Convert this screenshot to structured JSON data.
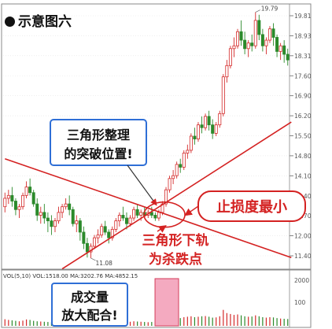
{
  "header": {
    "title": "示意图六"
  },
  "chart_data": {
    "type": "candlestick",
    "title": "示意图六",
    "price_axis": {
      "ticks": [
        "19.81",
        "18.93",
        "18.31",
        "17.60",
        "16.90",
        "16.20",
        "15.50",
        "14.80",
        "14.10",
        "13.40",
        "12.70",
        "12.00",
        "11.40"
      ],
      "ylim": [
        10.8,
        20.0
      ]
    },
    "high_label": "19.79",
    "low_label": "11.08",
    "volume_legend": "VOL(5,10) VOL:1518.00 MA:3202.76 MA:4852.15",
    "volume_axis": {
      "ticks": [
        "2000",
        "100"
      ]
    },
    "candles": [
      [
        12.9,
        13.4,
        13.2,
        12.7
      ],
      [
        13.2,
        13.5,
        13.3,
        13.0
      ],
      [
        13.3,
        13.6,
        13.1,
        12.9
      ],
      [
        13.1,
        13.2,
        12.8,
        12.6
      ],
      [
        12.8,
        13.0,
        12.9,
        12.5
      ],
      [
        12.9,
        13.4,
        13.3,
        12.8
      ],
      [
        13.3,
        13.8,
        13.6,
        13.2
      ],
      [
        13.6,
        13.9,
        13.4,
        13.3
      ],
      [
        13.4,
        13.5,
        13.0,
        12.9
      ],
      [
        13.0,
        13.2,
        12.6,
        12.4
      ],
      [
        12.6,
        12.9,
        12.7,
        12.3
      ],
      [
        12.7,
        13.0,
        12.5,
        12.3
      ],
      [
        12.5,
        12.7,
        12.4,
        12.0
      ],
      [
        12.4,
        12.6,
        12.2,
        11.9
      ],
      [
        12.2,
        12.5,
        12.4,
        12.0
      ],
      [
        12.4,
        12.9,
        12.7,
        12.3
      ],
      [
        12.7,
        13.0,
        12.9,
        12.5
      ],
      [
        12.9,
        13.2,
        13.0,
        12.8
      ],
      [
        13.0,
        13.3,
        12.8,
        12.6
      ],
      [
        12.8,
        12.9,
        12.3,
        12.2
      ],
      [
        12.3,
        12.6,
        12.4,
        12.0
      ],
      [
        12.4,
        12.5,
        12.0,
        11.7
      ],
      [
        12.0,
        12.2,
        11.6,
        11.4
      ],
      [
        11.6,
        11.8,
        11.3,
        11.1
      ],
      [
        11.3,
        11.6,
        11.5,
        11.08
      ],
      [
        11.5,
        11.9,
        11.8,
        11.4
      ],
      [
        11.8,
        12.1,
        11.9,
        11.6
      ],
      [
        11.9,
        12.3,
        12.2,
        11.8
      ],
      [
        12.2,
        12.4,
        12.0,
        11.9
      ],
      [
        12.0,
        12.1,
        11.8,
        11.6
      ],
      [
        11.8,
        12.2,
        12.1,
        11.7
      ],
      [
        12.1,
        12.5,
        12.4,
        12.0
      ],
      [
        12.4,
        12.7,
        12.6,
        12.2
      ],
      [
        12.6,
        12.9,
        12.5,
        12.4
      ],
      [
        12.5,
        12.7,
        12.3,
        12.1
      ],
      [
        12.3,
        12.6,
        12.5,
        12.2
      ],
      [
        12.5,
        12.9,
        12.8,
        12.4
      ],
      [
        12.8,
        13.0,
        12.6,
        12.5
      ],
      [
        12.6,
        12.8,
        12.7,
        12.4
      ],
      [
        12.7,
        12.9,
        12.6,
        12.5
      ],
      [
        12.6,
        12.8,
        12.7,
        12.5
      ],
      [
        12.7,
        12.9,
        12.6,
        12.5
      ],
      [
        12.6,
        12.7,
        12.5,
        12.4
      ],
      [
        12.5,
        12.8,
        12.7,
        12.4
      ],
      [
        12.7,
        13.1,
        13.0,
        12.6
      ],
      [
        13.0,
        13.6,
        13.5,
        12.9
      ],
      [
        13.5,
        14.0,
        13.9,
        13.4
      ],
      [
        13.9,
        14.2,
        14.0,
        13.7
      ],
      [
        14.0,
        14.5,
        14.4,
        13.9
      ],
      [
        14.4,
        14.6,
        14.3,
        14.1
      ],
      [
        14.3,
        14.9,
        14.8,
        14.2
      ],
      [
        14.8,
        15.1,
        14.9,
        14.6
      ],
      [
        14.9,
        15.5,
        15.4,
        14.8
      ],
      [
        15.4,
        15.7,
        15.3,
        15.1
      ],
      [
        15.3,
        15.9,
        15.8,
        15.2
      ],
      [
        15.8,
        16.1,
        15.7,
        15.5
      ],
      [
        15.7,
        16.2,
        16.1,
        15.6
      ],
      [
        16.1,
        16.3,
        15.8,
        15.6
      ],
      [
        15.8,
        16.0,
        15.5,
        15.3
      ],
      [
        15.5,
        15.9,
        15.8,
        15.4
      ],
      [
        15.8,
        16.3,
        16.2,
        15.7
      ],
      [
        16.2,
        17.6,
        17.5,
        16.1
      ],
      [
        17.5,
        18.1,
        17.9,
        17.3
      ],
      [
        17.9,
        18.6,
        18.5,
        17.8
      ],
      [
        18.5,
        18.9,
        18.6,
        18.2
      ],
      [
        18.6,
        19.2,
        19.1,
        18.5
      ],
      [
        19.1,
        19.5,
        18.8,
        18.6
      ],
      [
        18.8,
        19.1,
        18.5,
        18.3
      ],
      [
        18.5,
        18.8,
        18.7,
        18.2
      ],
      [
        18.7,
        19.0,
        18.6,
        18.4
      ],
      [
        18.6,
        19.79,
        19.5,
        18.5
      ],
      [
        19.5,
        19.7,
        19.0,
        18.8
      ],
      [
        19.0,
        19.2,
        18.6,
        18.4
      ],
      [
        18.6,
        18.9,
        18.8,
        18.3
      ],
      [
        18.8,
        19.3,
        19.2,
        18.7
      ],
      [
        19.2,
        19.4,
        18.9,
        18.6
      ],
      [
        18.9,
        19.0,
        18.4,
        18.2
      ],
      [
        18.4,
        18.7,
        18.6,
        18.1
      ],
      [
        18.6,
        18.8,
        18.3,
        18.0
      ],
      [
        18.3,
        18.5,
        18.1,
        17.9
      ]
    ],
    "volumes": [
      290,
      260,
      240,
      220,
      200,
      230,
      280,
      260,
      220,
      200,
      190,
      180,
      170,
      160,
      170,
      190,
      210,
      220,
      200,
      180,
      170,
      160,
      150,
      140,
      130,
      150,
      170,
      180,
      170,
      160,
      170,
      190,
      200,
      210,
      190,
      180,
      200,
      190,
      180,
      170,
      160,
      170,
      150,
      160,
      190,
      2000,
      420,
      380,
      360,
      340,
      380,
      400,
      420,
      380,
      400,
      420,
      430,
      400,
      360,
      370,
      420,
      700,
      560,
      520,
      480,
      500,
      460,
      420,
      400,
      410,
      460,
      420,
      380,
      360,
      380,
      370,
      340,
      320,
      310,
      300
    ],
    "breakout_index": 45,
    "trend_lines": [
      {
        "name": "triangle-upper",
        "from": [
          0,
          14.6
        ],
        "to": [
          80,
          11.1
        ]
      },
      {
        "name": "triangle-lower",
        "from": [
          16,
          10.7
        ],
        "to": [
          80,
          15.9
        ]
      }
    ],
    "annotations": [
      {
        "id": "breakout",
        "text_lines": [
          "三角形整理",
          "的突破位置!"
        ]
      },
      {
        "id": "stoploss",
        "text_lines": [
          "止损度最小"
        ]
      },
      {
        "id": "lower_track",
        "text_lines": [
          "三角形下轨",
          "为杀跌点"
        ]
      },
      {
        "id": "volume",
        "text_lines": [
          "成交量",
          "放大配合!"
        ]
      }
    ],
    "colors": {
      "up": "#d42a2a",
      "down": "#2b8a2b",
      "trend": "#d42222",
      "box_border": "#2f6fd6",
      "volume_highlight": "#f4aac0"
    }
  }
}
